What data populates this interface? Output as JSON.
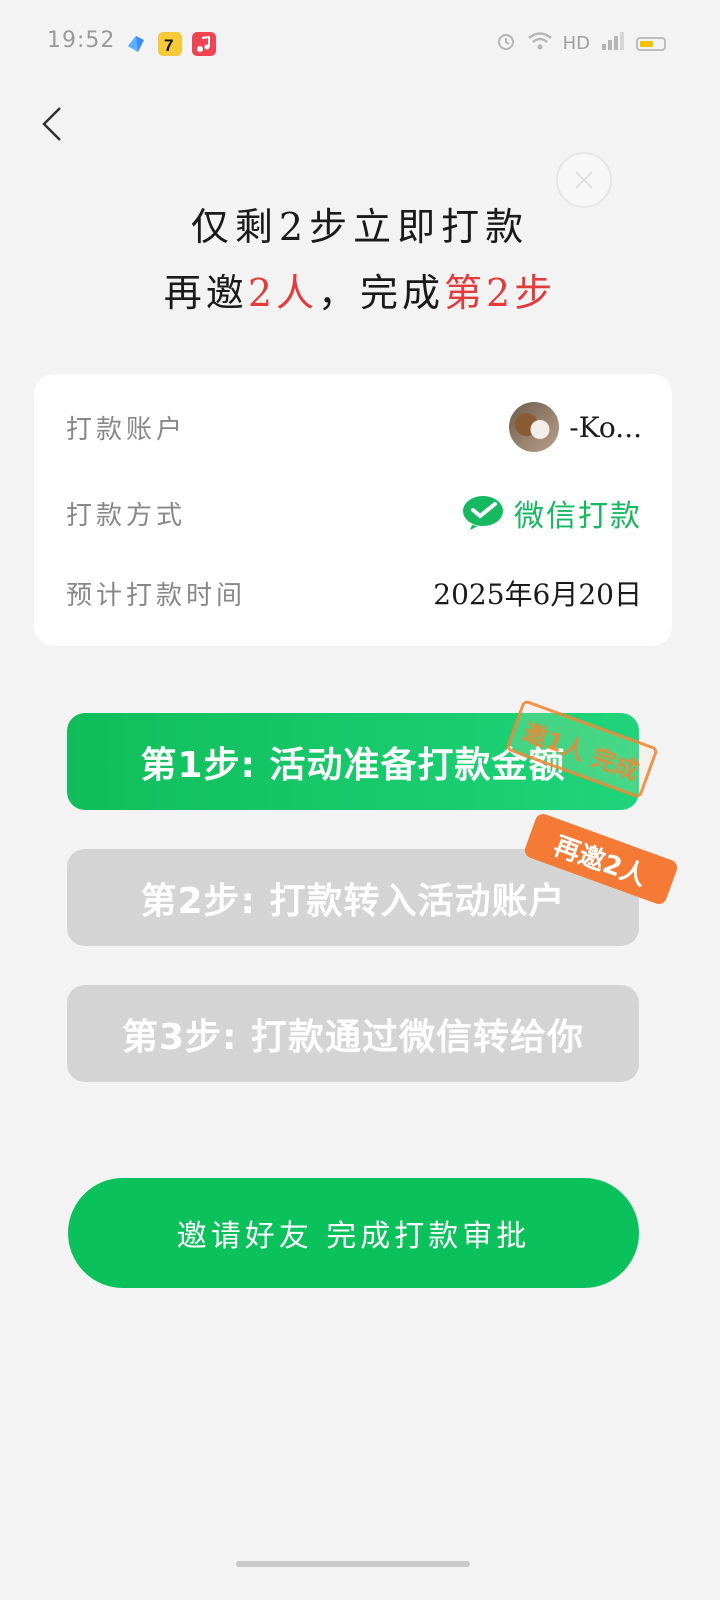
{
  "status_bar": {
    "time": "19:52",
    "network": "HD",
    "icons": [
      "message-app-icon",
      "game-app-icon",
      "music-app-icon",
      "alarm-icon",
      "wifi-icon",
      "signal-icon",
      "battery-icon"
    ]
  },
  "header": {
    "line1": "仅剩2步立即打款",
    "line2_prefix": "再邀",
    "line2_highlight": "2人",
    "line2_middle": "，完成",
    "line2_step": "第2步"
  },
  "info_card": {
    "rows": [
      {
        "label": "打款账户",
        "value": "-Ko..."
      },
      {
        "label": "打款方式",
        "value": "微信打款"
      },
      {
        "label": "预计打款时间",
        "value": "2025年6月20日"
      }
    ]
  },
  "steps": [
    {
      "label": "第1步: 活动准备打款金额",
      "status": "done",
      "badge": "邀1人 完成"
    },
    {
      "label": "第2步: 打款转入活动账户",
      "status": "pending",
      "badge": "再邀2人"
    },
    {
      "label": "第3步: 打款通过微信转给你",
      "status": "pending"
    }
  ],
  "cta": {
    "label": "邀请好友 完成打款审批"
  },
  "colors": {
    "accent_green": "#0bc15c",
    "highlight_red": "#e33b3b",
    "badge_orange": "#f47a35"
  }
}
